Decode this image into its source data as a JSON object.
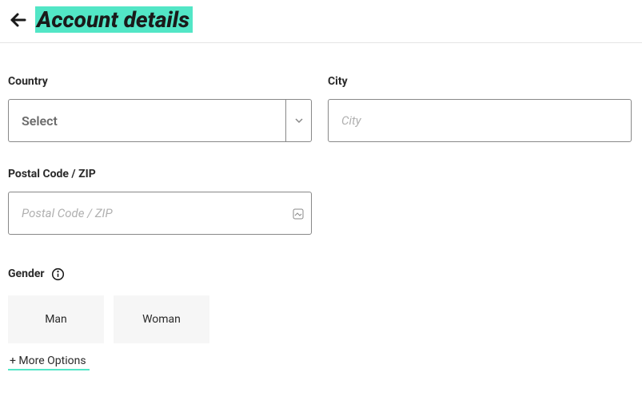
{
  "header": {
    "title": "Account details"
  },
  "form": {
    "country": {
      "label": "Country",
      "selected": "Select"
    },
    "city": {
      "label": "City",
      "placeholder": "City",
      "value": ""
    },
    "postal": {
      "label": "Postal Code / ZIP",
      "placeholder": "Postal Code / ZIP",
      "value": ""
    },
    "gender": {
      "label": "Gender",
      "options": {
        "man": "Man",
        "woman": "Woman"
      },
      "more": "+ More Options"
    }
  }
}
